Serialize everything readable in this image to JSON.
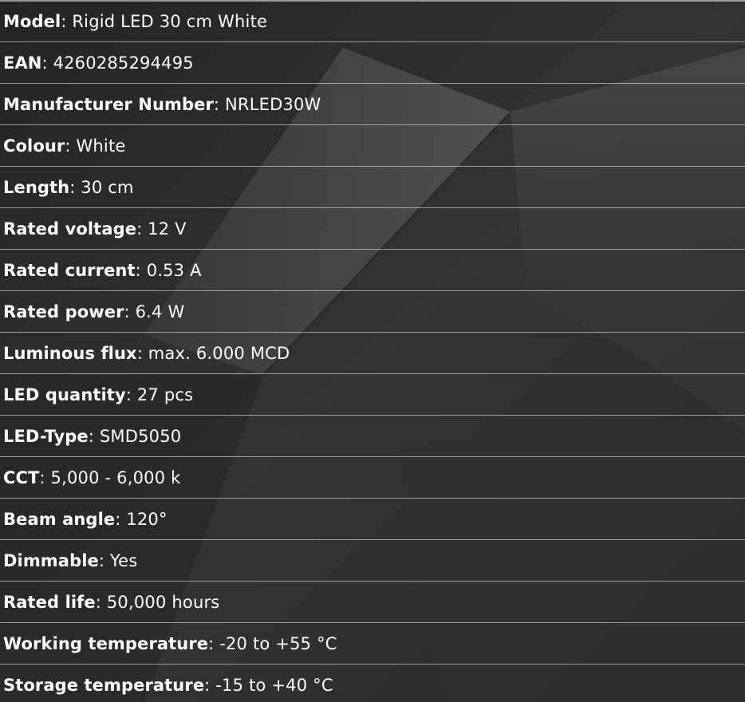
{
  "specs": [
    {
      "label": "Model",
      "value": "Rigid LED 30 cm White"
    },
    {
      "label": "EAN",
      "value": "4260285294495"
    },
    {
      "label": "Manufacturer Number",
      "value": "NRLED30W"
    },
    {
      "label": "Colour",
      "value": "White"
    },
    {
      "label": "Length",
      "value": "30 cm"
    },
    {
      "label": "Rated voltage",
      "value": "12 V"
    },
    {
      "label": "Rated current",
      "value": "0.53 A"
    },
    {
      "label": "Rated power",
      "value": "6.4 W"
    },
    {
      "label": "Luminous flux",
      "value": "max. 6.000 MCD"
    },
    {
      "label": "LED quantity",
      "value": "27 pcs"
    },
    {
      "label": "LED-Type",
      "value": "SMD5050"
    },
    {
      "label": "CCT",
      "value": "5,000 - 6,000 k"
    },
    {
      "label": "Beam angle",
      "value": "120°"
    },
    {
      "label": "Dimmable",
      "value": "Yes"
    },
    {
      "label": "Rated life",
      "value": "50,000 hours"
    },
    {
      "label": "Working temperature",
      "value": "-20 to +55 °C"
    },
    {
      "label": "Storage temperature",
      "value": "-15 to +40 °C"
    }
  ],
  "separator": ":",
  "colors": {
    "background": "#2b2b2b",
    "text": "#ffffff",
    "divider": "#d8d8d8"
  }
}
